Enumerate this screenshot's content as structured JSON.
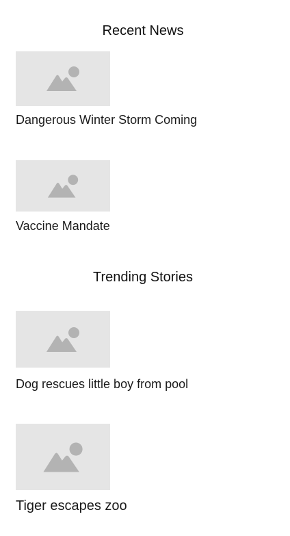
{
  "recent_news": {
    "title": "Recent News",
    "items": [
      {
        "headline": "Dangerous Winter Storm Coming",
        "image_icon": "image-placeholder-icon"
      },
      {
        "headline": "Vaccine Mandate",
        "image_icon": "image-placeholder-icon"
      }
    ]
  },
  "trending_stories": {
    "title": "Trending Stories",
    "items": [
      {
        "headline": "Dog rescues little boy from pool",
        "image_icon": "image-placeholder-icon"
      },
      {
        "headline": "Tiger escapes zoo",
        "image_icon": "image-placeholder-icon"
      }
    ]
  },
  "colors": {
    "placeholder_bg": "#e5e5e5",
    "placeholder_icon": "#b3b3b3",
    "text": "#1a1a1a"
  }
}
